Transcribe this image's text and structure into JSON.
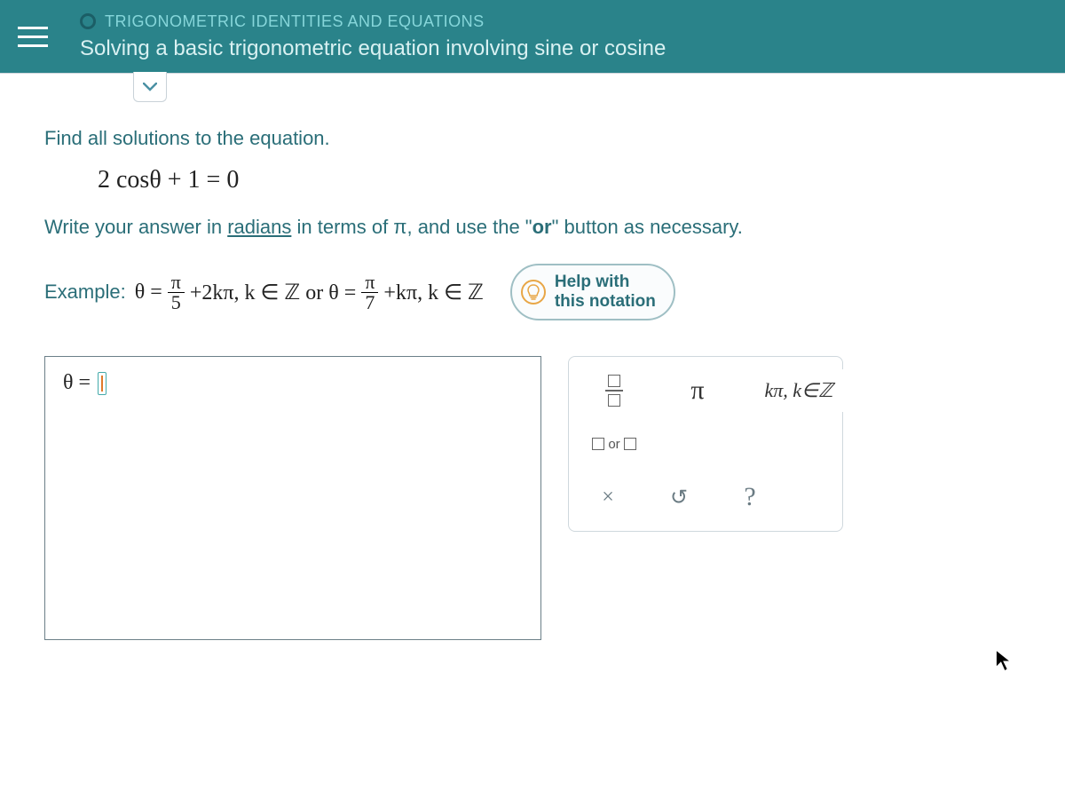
{
  "header": {
    "breadcrumb": "TRIGONOMETRIC IDENTITIES AND EQUATIONS",
    "lesson_title": "Solving a basic trigonometric equation involving sine or cosine"
  },
  "content": {
    "instruction1": "Find all solutions to the equation.",
    "equation": "2 cosθ + 1 = 0",
    "instruction2_pre": "Write your answer in ",
    "instruction2_underline": "radians",
    "instruction2_mid": " in terms of π, and use the \"",
    "instruction2_bold": "or",
    "instruction2_post": "\" button as necessary."
  },
  "example": {
    "label": "Example:",
    "theta_eq": "θ =",
    "frac1_num": "π",
    "frac1_den": "5",
    "part1_tail": "+2kπ, k ∈ ℤ or θ =",
    "frac2_num": "π",
    "frac2_den": "7",
    "part2_tail": "+kπ, k ∈ ℤ"
  },
  "help": {
    "line1": "Help with",
    "line2": "this notation"
  },
  "answer": {
    "theta_eq": "θ ="
  },
  "palette": {
    "pi": "π",
    "kpi": "kπ, k∈ℤ",
    "or_label": "or",
    "clear": "×",
    "reset": "↺",
    "help": "?"
  }
}
